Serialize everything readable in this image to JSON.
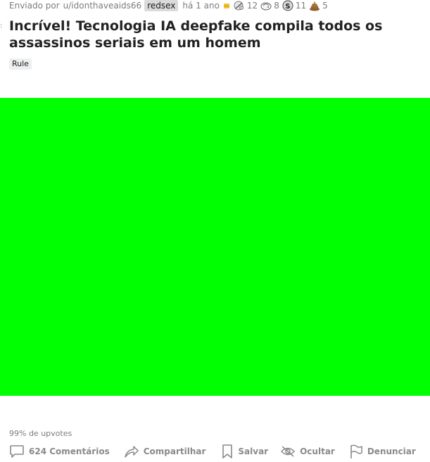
{
  "post": {
    "submitted_prefix": "Enviado por",
    "author": "u/idonthaveaids66",
    "flair": "redsex",
    "time_ago": "há 1 ano",
    "awards": [
      {
        "icon": "silver-award-icon",
        "count": ""
      },
      {
        "icon": "helpful-award-icon",
        "count": "12"
      },
      {
        "icon": "wholesome-award-icon",
        "count": "8"
      },
      {
        "icon": "coin-award-icon",
        "count": "11"
      },
      {
        "icon": "poop-award-icon",
        "count": "5"
      }
    ],
    "title": "Incrível! Tecnologia IA deepfake compila todos os assassinos seriais em um homem",
    "tag": "Rule",
    "media_color": "#00ff00",
    "upvote_ratio": "99% de upvotes"
  },
  "actions": {
    "comments": "624 Comentários",
    "share": "Compartilhar",
    "save": "Salvar",
    "hide": "Ocultar",
    "report": "Denunciar"
  }
}
